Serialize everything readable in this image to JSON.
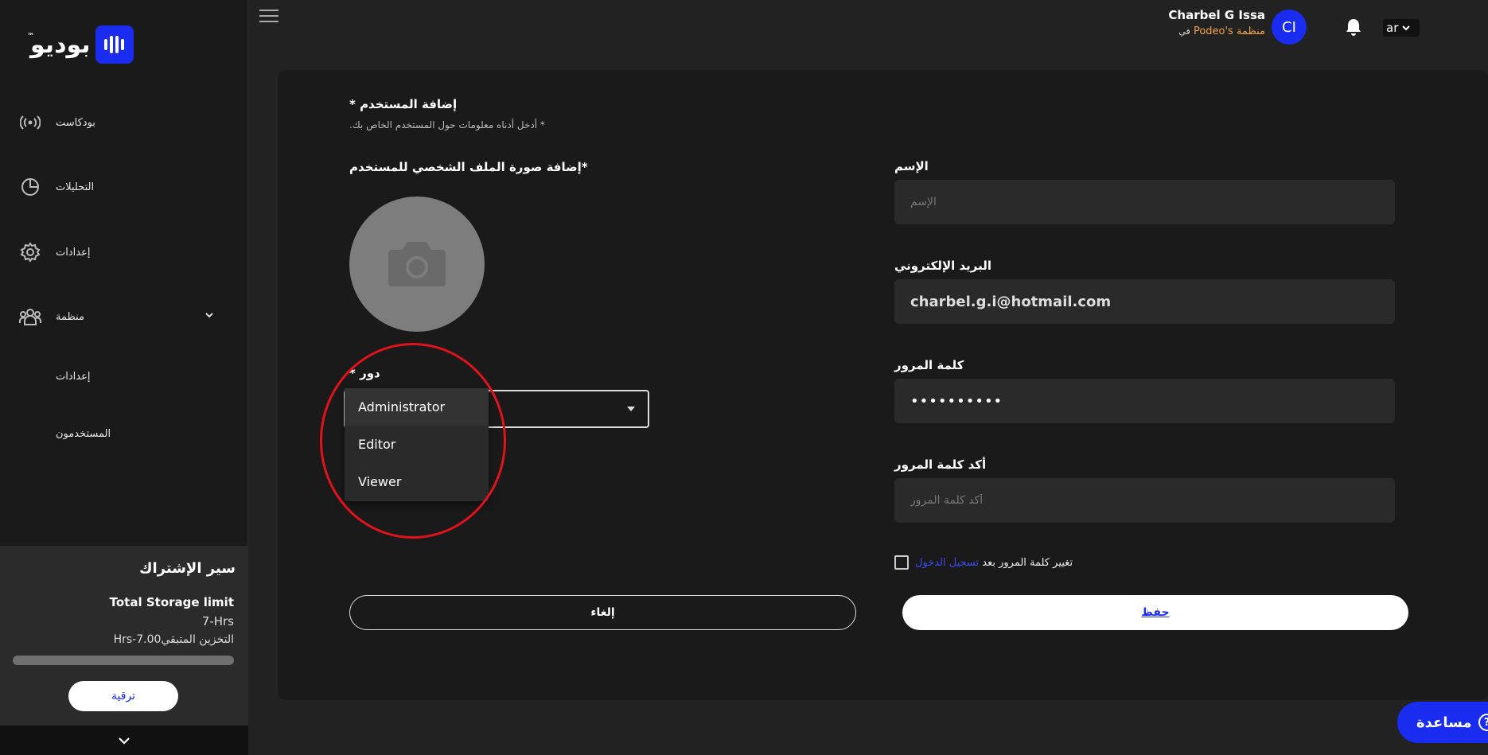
{
  "brand": {
    "logo_text": "بوديو",
    "tm": "™"
  },
  "sidebar": {
    "items": [
      {
        "label": "بودكاست",
        "icon": "broadcast-icon"
      },
      {
        "label": "التحليلات",
        "icon": "pie-chart-icon"
      },
      {
        "label": "إعدادات",
        "icon": "gear-icon"
      },
      {
        "label": "منظمة",
        "icon": "users-group-icon"
      }
    ],
    "sub_items": [
      {
        "label": "إعدادات"
      },
      {
        "label": "المستخدمون"
      }
    ]
  },
  "subscription": {
    "title": "سير الإشتراك",
    "storage_title": "Total Storage limit",
    "storage_hrs": "7-Hrs",
    "remaining_label": "التخزين المتبقي",
    "remaining_value": "7.00-Hrs",
    "used_fraction": 0,
    "upgrade_label": "ترقية"
  },
  "header": {
    "user_name": "Charbel G Issa",
    "org_name": "منظمة Podeo's",
    "org_prefix": "في",
    "avatar_initials": "CI",
    "lang": "ar"
  },
  "form": {
    "title": "إضافة المستخدم *",
    "subtitle": "* أدخل أدناه معلومات حول المستخدم الخاص بك.",
    "photo_label": "*إضافة صورة الملف الشخصي للمستخدم",
    "role_label": "دور *",
    "role_options": [
      "Administrator",
      "Editor",
      "Viewer"
    ],
    "name_label": "الإسم",
    "name_placeholder": "الإسم",
    "email_label": "البريد الإلكتروني",
    "email_value": "charbel.g.i@hotmail.com",
    "password_label": "كلمة المرور",
    "password_value": "••••••••••",
    "confirm_label": "أكد كلمة المرور",
    "confirm_placeholder": "أكد كلمة المرور",
    "checkbox_text": "تغيير كلمة المرور بعد",
    "checkbox_link": "تسجيل الدخول",
    "cancel_label": "إلغاء",
    "save_label": "حفظ"
  },
  "help": {
    "label": "مساعدة"
  }
}
